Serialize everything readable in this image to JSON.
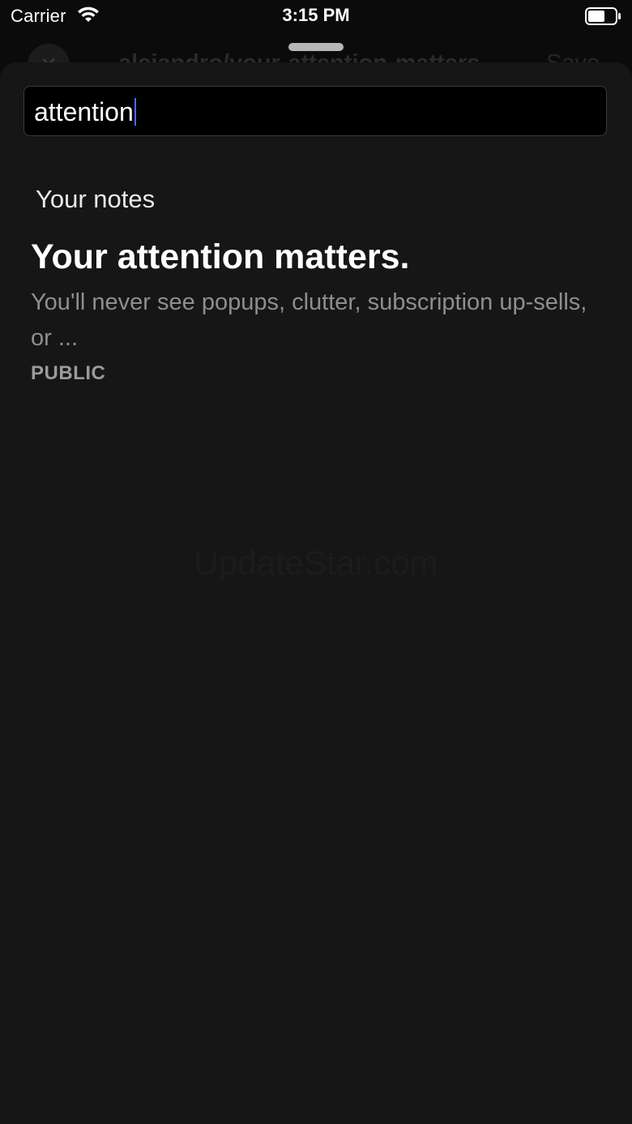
{
  "status_bar": {
    "carrier": "Carrier",
    "time": "3:15 PM",
    "wifi_icon": "wifi-icon",
    "battery_icon": "battery-icon"
  },
  "behind": {
    "close_icon": "close-icon",
    "title": "alejandro/your-attention-matters",
    "save_label": "Save"
  },
  "search": {
    "value": "attention"
  },
  "results": {
    "section_heading": "Your notes",
    "notes": [
      {
        "title": "Your attention matters.",
        "excerpt": "You'll never see popups, clutter, subscription up-sells, or ...",
        "visibility": "PUBLIC"
      }
    ]
  },
  "watermark": "UpdateStar.com",
  "colors": {
    "background": "#0b0b0b",
    "sheet": "#161617",
    "field": "#000000",
    "caret": "#4a6cff"
  }
}
